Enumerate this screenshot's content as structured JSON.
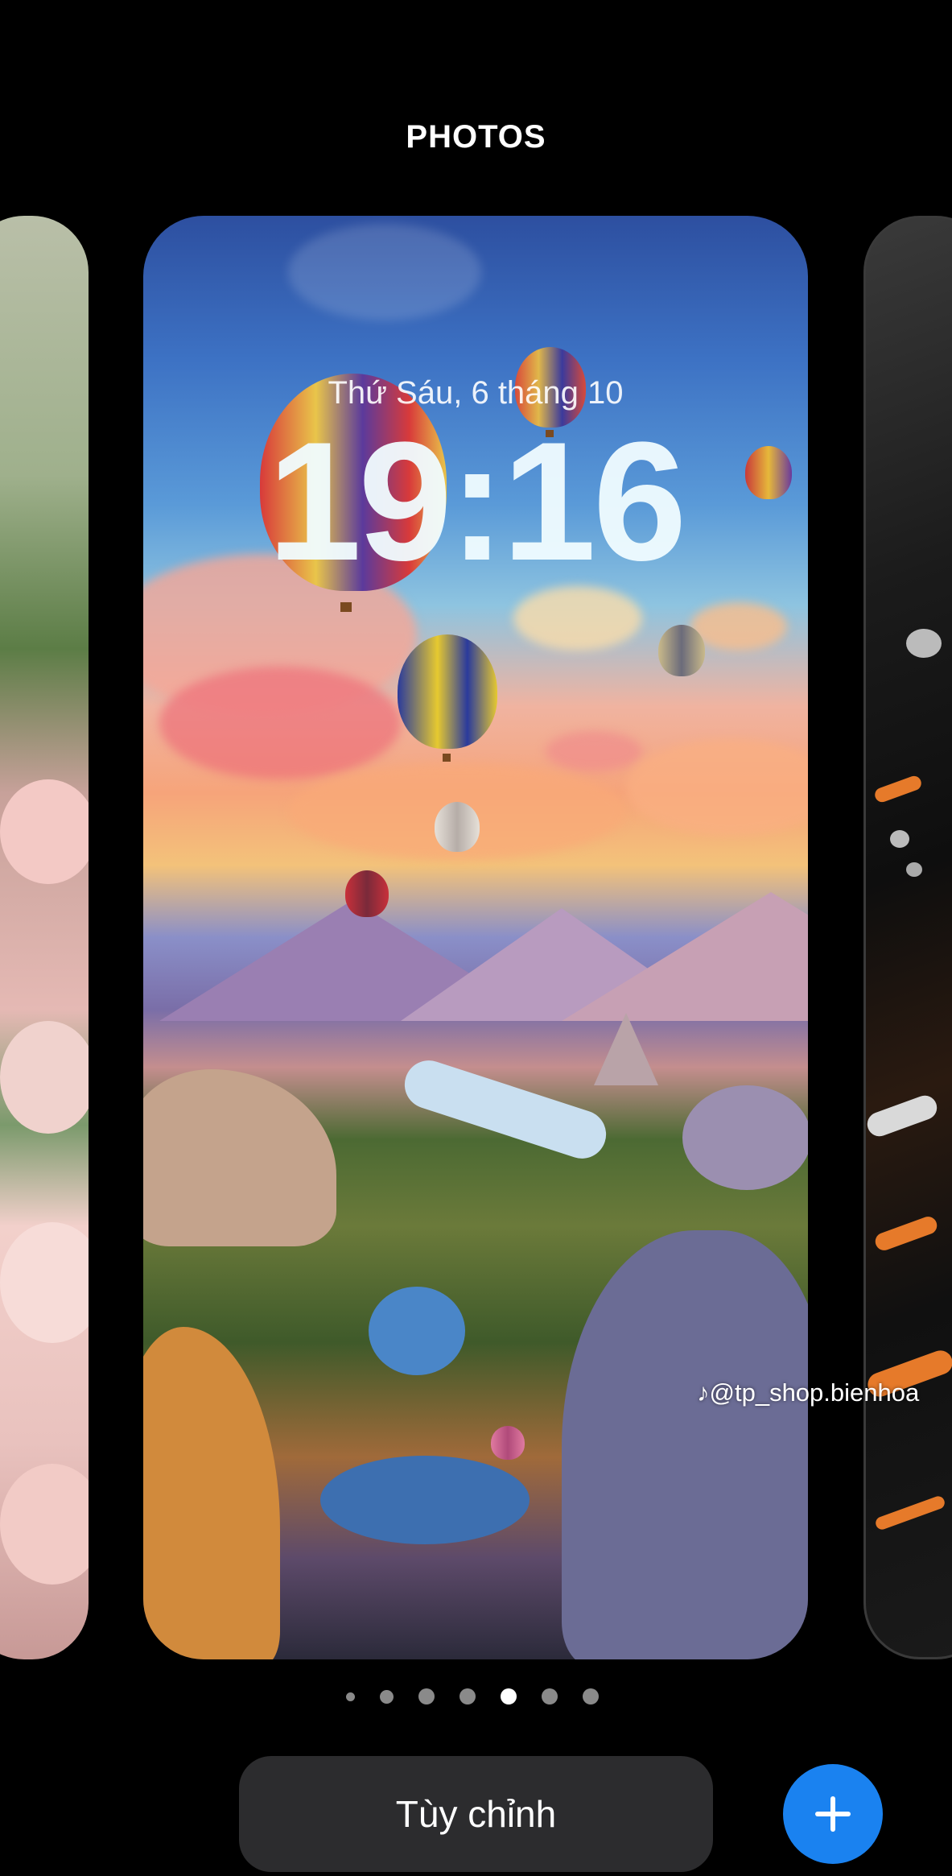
{
  "header": {
    "title": "PHOTOS"
  },
  "lockscreen": {
    "date": "Thứ Sáu, 6 tháng 10",
    "time": "19:16"
  },
  "watermark": {
    "text": "@tp_shop.bienhoa",
    "icon": "tiktok-icon"
  },
  "pagination": {
    "count": 7,
    "active_index": 4
  },
  "actions": {
    "customize_label": "Tùy chỉnh",
    "add_icon": "plus-icon"
  },
  "colors": {
    "accent": "#1a82f0",
    "button_bg": "#2c2c2e"
  }
}
